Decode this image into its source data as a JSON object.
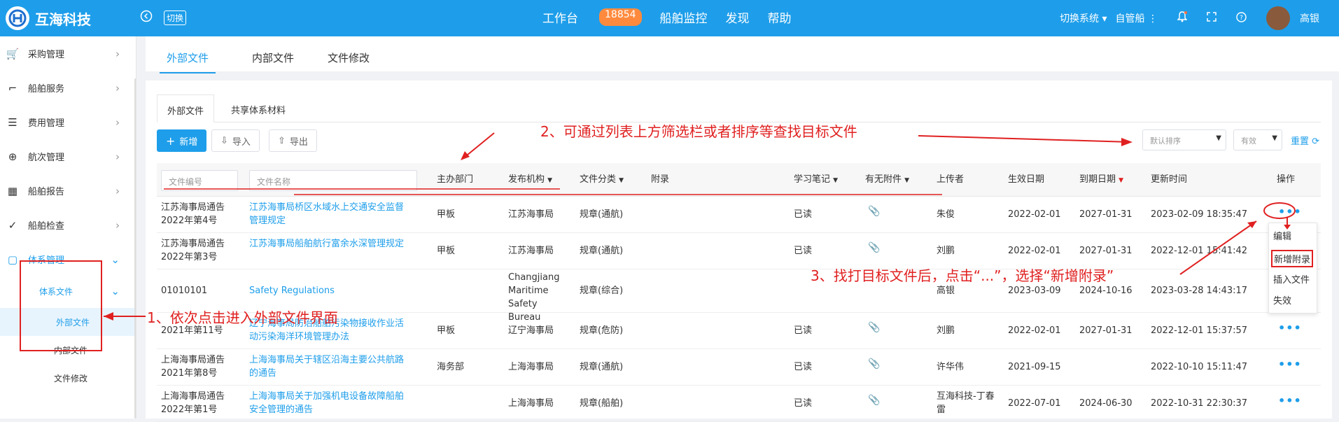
{
  "app": {
    "logo_text": "互海科技",
    "switch_label": "切换"
  },
  "topnav": {
    "workbench": "工作台",
    "workbench_count": "18854",
    "items": [
      "船舶监控",
      "发现",
      "帮助"
    ]
  },
  "top_right": {
    "switch_system": "切换系统",
    "own_ship": "自管船",
    "user_name": "高银"
  },
  "sidebar": {
    "items": [
      {
        "label": "采购管理",
        "icon": "cart-icon"
      },
      {
        "label": "船舶服务",
        "icon": "paint-roller-icon"
      },
      {
        "label": "费用管理",
        "icon": "database-icon"
      },
      {
        "label": "航次管理",
        "icon": "globe-icon"
      },
      {
        "label": "船舶报告",
        "icon": "calendar-icon"
      },
      {
        "label": "船舶检查",
        "icon": "check-circle-icon"
      },
      {
        "label": "体系管理",
        "icon": "document-icon"
      }
    ],
    "sub_group": "体系文件",
    "sub_items": [
      "外部文件",
      "内部文件",
      "文件修改"
    ]
  },
  "main_tabs": [
    "外部文件",
    "内部文件",
    "文件修改"
  ],
  "sub_tabs": [
    "外部文件",
    "共享体系材料"
  ],
  "toolbar": {
    "add": "新增",
    "import": "导入",
    "export": "导出",
    "sort_select": "默认排序",
    "status_select": "有效",
    "reset": "重置"
  },
  "table": {
    "filters": {
      "file_no": "文件编号",
      "file_name": "文件名称"
    },
    "headers": [
      "主办部门",
      "发布机构",
      "文件分类",
      "附录",
      "学习笔记",
      "有无附件",
      "上传者",
      "生效日期",
      "到期日期",
      "更新时间",
      "操作"
    ],
    "rows": [
      {
        "no": "江苏海事局通告2022年第4号",
        "name": "江苏海事局桥区水域水上交通安全监督管理规定",
        "dept": "甲板",
        "org": "江苏海事局",
        "cat": "规章(通航)",
        "note": "已读",
        "attach": true,
        "uploader": "朱俊",
        "eff": "2022-02-01",
        "exp": "2027-01-31",
        "upd": "2023-02-09 18:35:47"
      },
      {
        "no": "江苏海事局通告2022年第3号",
        "name": "江苏海事局船舶航行富余水深管理规定",
        "dept": "甲板",
        "org": "江苏海事局",
        "cat": "规章(通航)",
        "note": "已读",
        "attach": true,
        "uploader": "刘鹏",
        "eff": "2022-02-01",
        "exp": "2027-01-31",
        "upd": "2022-12-01 15:41:42"
      },
      {
        "no": "01010101",
        "name": "Safety Regulations",
        "dept": "",
        "org": "Changjiang Maritime Safety Bureau",
        "cat": "规章(综合)",
        "note": "",
        "attach": false,
        "uploader": "高银",
        "eff": "2023-03-09",
        "exp": "2024-10-16",
        "upd": "2023-03-28 14:43:17"
      },
      {
        "no": "2021年第11号",
        "name": "辽宁海事局防治船舶污染物接收作业活动污染海洋环境管理办法",
        "dept": "甲板",
        "org": "辽宁海事局",
        "cat": "规章(危防)",
        "note": "已读",
        "attach": true,
        "uploader": "刘鹏",
        "eff": "2022-02-01",
        "exp": "2027-01-31",
        "upd": "2022-12-01 15:37:57"
      },
      {
        "no": "上海海事局通告2021年第8号",
        "name": "上海海事局关于辖区沿海主要公共航路的通告",
        "dept": "海务部",
        "org": "上海海事局",
        "cat": "规章(通航)",
        "note": "已读",
        "attach": true,
        "uploader": "许华伟",
        "eff": "2021-09-15",
        "exp": "",
        "upd": "2022-10-10 15:11:47"
      },
      {
        "no": "上海海事局通告2022年第1号",
        "name": "上海海事局关于加强机电设备故障船舶安全管理的通告",
        "dept": "",
        "org": "上海海事局",
        "cat": "规章(船舶)",
        "note": "已读",
        "attach": true,
        "uploader": "互海科技-丁春雷",
        "eff": "2022-07-01",
        "exp": "2024-06-30",
        "upd": "2022-10-31 22:30:37"
      }
    ],
    "row_menu": [
      "编辑",
      "新增附录",
      "插入文件",
      "失效"
    ]
  },
  "annotations": {
    "step1": "1、依次点击进入外部文件界面",
    "step2": "2、可通过列表上方筛选栏或者排序等查找目标文件",
    "step3": "3、找打目标文件后，点击“...”，选择“新增附录”"
  }
}
